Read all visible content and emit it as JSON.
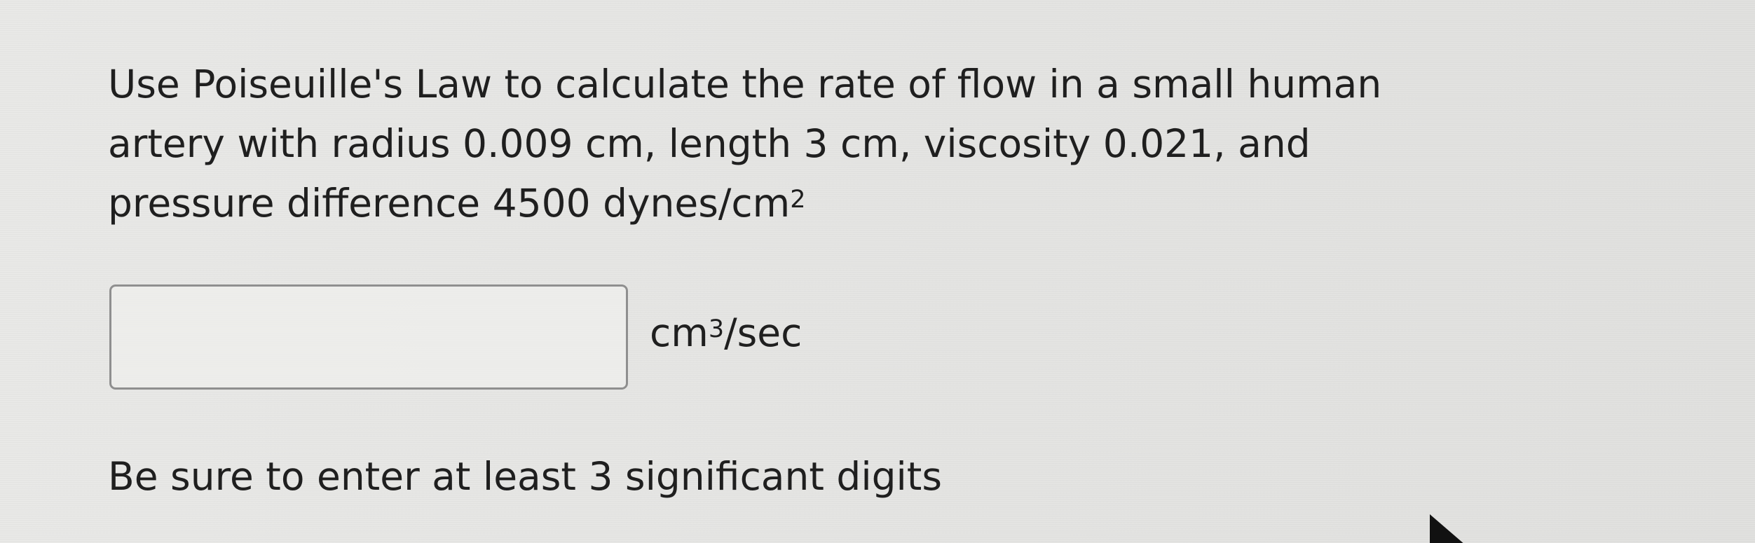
{
  "question": {
    "line_1": "Use Poiseuille's Law to calculate the rate of flow in a small human",
    "line_2": "artery with radius 0.009 cm, length 3 cm, viscosity 0.021, and",
    "line_3_prefix": "pressure difference 4500 dynes/cm",
    "line_3_superscript": "2"
  },
  "answer": {
    "value": "",
    "placeholder": "",
    "unit_prefix": "cm",
    "unit_superscript": "3",
    "unit_suffix": "/sec"
  },
  "instruction": {
    "text": "Be sure to enter at least 3 significant digits"
  },
  "icons": {
    "pointer": "mouse-pointer-icon"
  },
  "colors": {
    "background": "#e8e8e6",
    "text": "#1f1f1f",
    "input_border": "#8f8f8f"
  }
}
